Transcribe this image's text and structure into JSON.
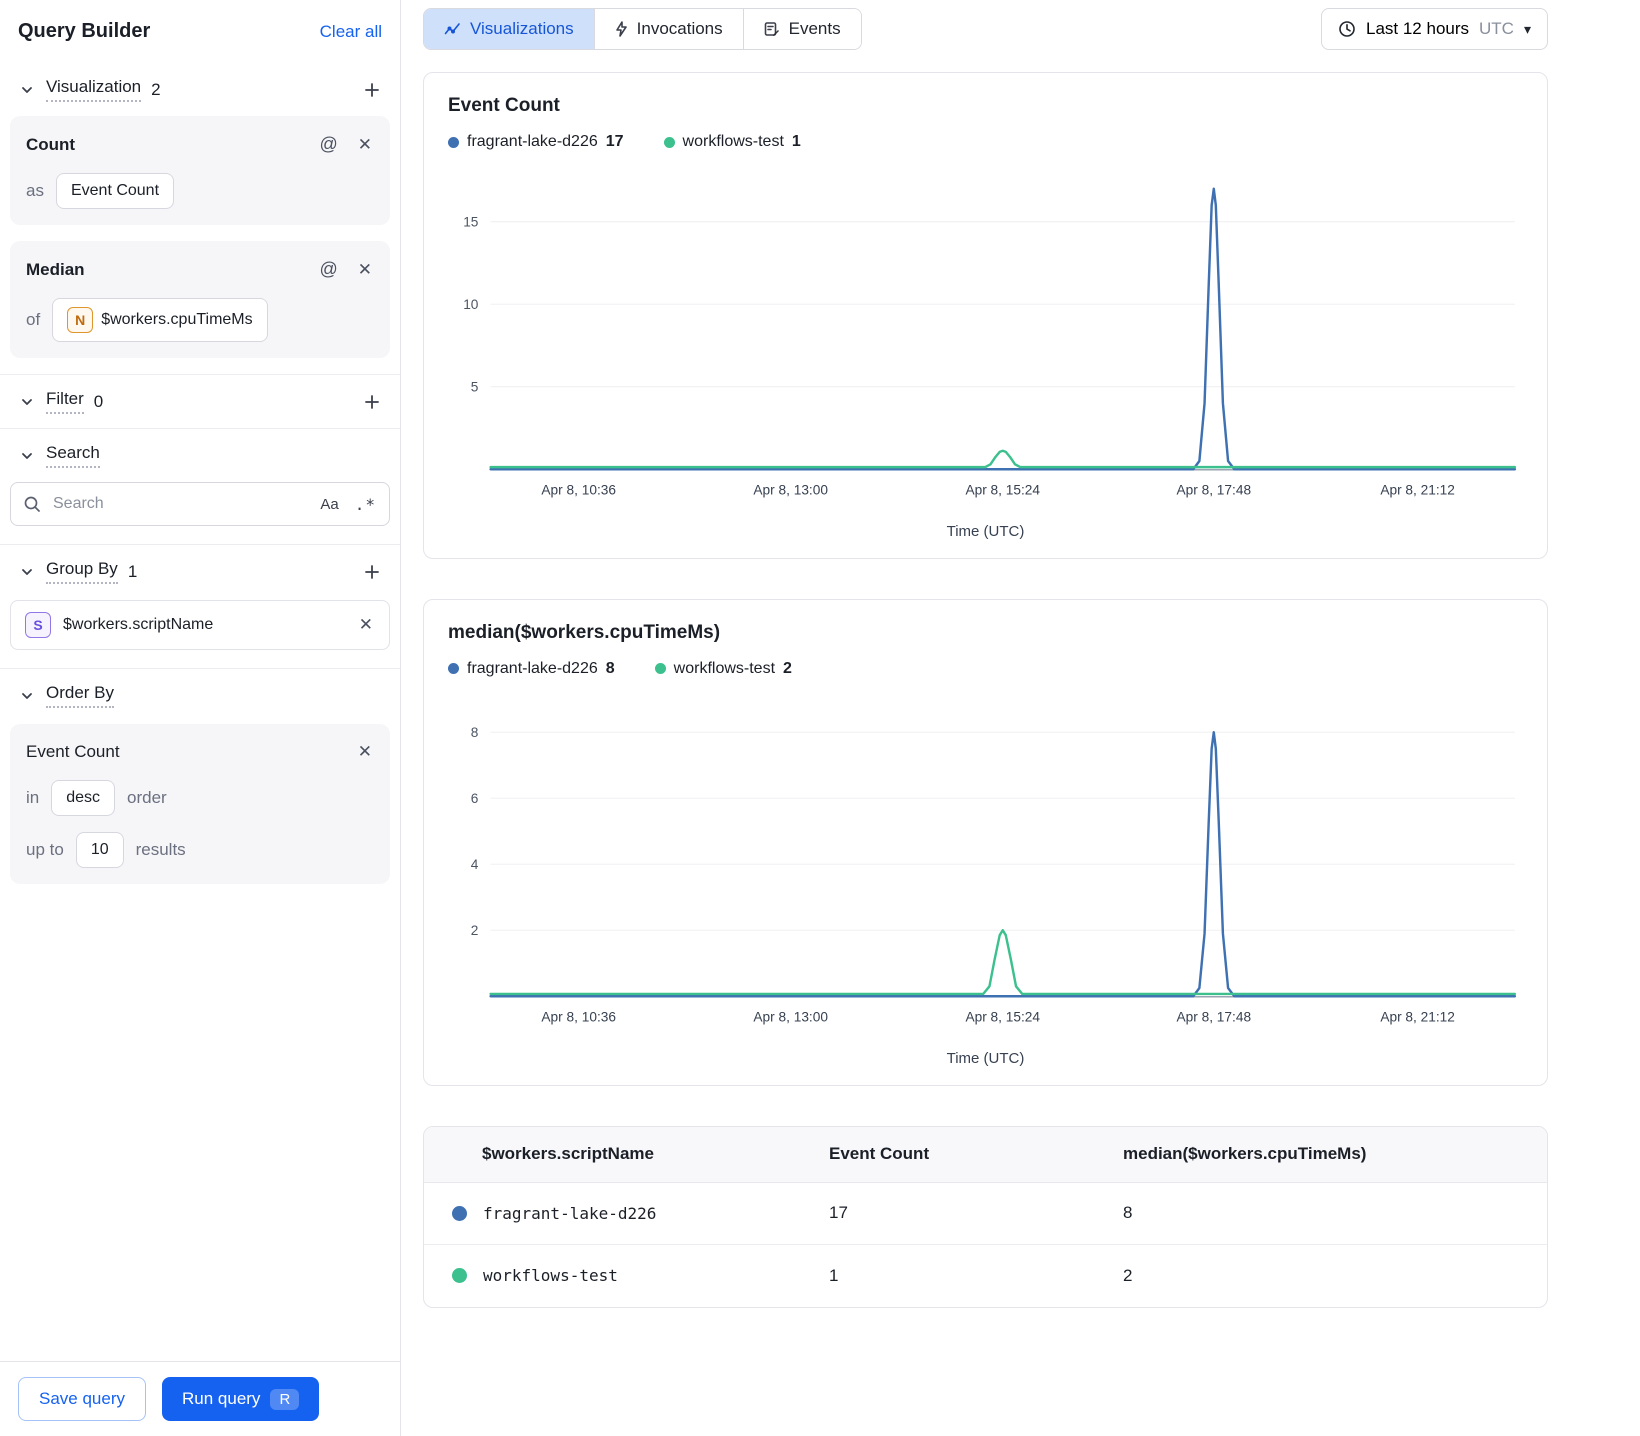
{
  "colors": {
    "accent_blue": "#1662f0",
    "tab_active_bg": "#cfe0fb",
    "series_blue": "#3e70b2",
    "series_green": "#3cc08d"
  },
  "icons": {
    "at_sign": "@",
    "close": "✕",
    "case_sensitive": "Aa",
    "regex": ".*",
    "caret_down": "▾"
  },
  "sidebar": {
    "title": "Query Builder",
    "clear_all": "Clear all",
    "visualization": {
      "label": "Visualization",
      "count": "2",
      "cards": [
        {
          "title": "Count",
          "prefix": "as",
          "value": "Event Count"
        },
        {
          "title": "Median",
          "prefix": "of",
          "badge": "N",
          "value": "$workers.cpuTimeMs"
        }
      ]
    },
    "filter": {
      "label": "Filter",
      "count": "0"
    },
    "search": {
      "label": "Search",
      "placeholder": "Search"
    },
    "group_by": {
      "label": "Group By",
      "count": "1",
      "items": [
        {
          "badge": "S",
          "value": "$workers.scriptName"
        }
      ]
    },
    "order_by": {
      "label": "Order By",
      "card": {
        "title": "Event Count",
        "in_label": "in",
        "order_value": "desc",
        "order_suffix": "order",
        "upto_label": "up to",
        "limit": "10",
        "results_label": "results"
      }
    },
    "footer": {
      "save": "Save query",
      "run": "Run query",
      "run_kbd": "R"
    }
  },
  "header": {
    "tabs": [
      {
        "label": "Visualizations",
        "active": true
      },
      {
        "label": "Invocations",
        "active": false
      },
      {
        "label": "Events",
        "active": false
      }
    ],
    "time_range": {
      "label": "Last 12 hours",
      "tz": "UTC"
    }
  },
  "chart_data": [
    {
      "type": "line",
      "title": "Event Count",
      "xlabel": "Time (UTC)",
      "ylim": [
        0,
        17.7
      ],
      "y_ticks": [
        "15",
        "10",
        "5"
      ],
      "x_ticks": [
        {
          "pos": 0.086,
          "label": "Apr 8, 10:36"
        },
        {
          "pos": 0.293,
          "label": "Apr 8, 13:00"
        },
        {
          "pos": 0.5,
          "label": "Apr 8, 15:24"
        },
        {
          "pos": 0.706,
          "label": "Apr 8, 17:48"
        },
        {
          "pos": 0.905,
          "label": "Apr 8, 21:12"
        }
      ],
      "legend": [
        {
          "name": "fragrant-lake-d226",
          "value": "17",
          "color": "#3e70b2"
        },
        {
          "name": "workflows-test",
          "value": "1",
          "color": "#3cc08d"
        }
      ],
      "series": [
        {
          "name": "fragrant-lake-d226",
          "color": "#3e70b2",
          "points": [
            [
              0,
              0
            ],
            [
              0.686,
              0
            ],
            [
              0.692,
              0.5
            ],
            [
              0.697,
              4
            ],
            [
              0.701,
              11
            ],
            [
              0.704,
              16
            ],
            [
              0.706,
              17
            ],
            [
              0.708,
              16
            ],
            [
              0.711,
              11
            ],
            [
              0.715,
              4
            ],
            [
              0.72,
              0.5
            ],
            [
              0.726,
              0
            ],
            [
              1,
              0
            ]
          ]
        },
        {
          "name": "workflows-test",
          "color": "#3cc08d",
          "points": [
            [
              0,
              0.13
            ],
            [
              0.483,
              0.13
            ],
            [
              0.488,
              0.3
            ],
            [
              0.493,
              0.75
            ],
            [
              0.497,
              1.05
            ],
            [
              0.5,
              1.12
            ],
            [
              0.503,
              1.05
            ],
            [
              0.507,
              0.75
            ],
            [
              0.512,
              0.3
            ],
            [
              0.517,
              0.13
            ],
            [
              1,
              0.13
            ]
          ]
        }
      ]
    },
    {
      "type": "line",
      "title": "median($workers.cpuTimeMs)",
      "xlabel": "Time (UTC)",
      "ylim": [
        0,
        8.85
      ],
      "y_ticks": [
        "8",
        "6",
        "4",
        "2"
      ],
      "x_ticks": [
        {
          "pos": 0.086,
          "label": "Apr 8, 10:36"
        },
        {
          "pos": 0.293,
          "label": "Apr 8, 13:00"
        },
        {
          "pos": 0.5,
          "label": "Apr 8, 15:24"
        },
        {
          "pos": 0.706,
          "label": "Apr 8, 17:48"
        },
        {
          "pos": 0.905,
          "label": "Apr 8, 21:12"
        }
      ],
      "legend": [
        {
          "name": "fragrant-lake-d226",
          "value": "8",
          "color": "#3e70b2"
        },
        {
          "name": "workflows-test",
          "value": "2",
          "color": "#3cc08d"
        }
      ],
      "series": [
        {
          "name": "fragrant-lake-d226",
          "color": "#3e70b2",
          "points": [
            [
              0,
              0
            ],
            [
              0.686,
              0
            ],
            [
              0.692,
              0.25
            ],
            [
              0.697,
              1.9
            ],
            [
              0.701,
              5.2
            ],
            [
              0.704,
              7.5
            ],
            [
              0.706,
              8
            ],
            [
              0.708,
              7.5
            ],
            [
              0.711,
              5.2
            ],
            [
              0.715,
              1.9
            ],
            [
              0.72,
              0.25
            ],
            [
              0.726,
              0
            ],
            [
              1,
              0
            ]
          ]
        },
        {
          "name": "workflows-test",
          "color": "#3cc08d",
          "points": [
            [
              0,
              0.07
            ],
            [
              0.481,
              0.07
            ],
            [
              0.487,
              0.3
            ],
            [
              0.492,
              1.1
            ],
            [
              0.497,
              1.85
            ],
            [
              0.5,
              2
            ],
            [
              0.503,
              1.85
            ],
            [
              0.508,
              1.1
            ],
            [
              0.513,
              0.3
            ],
            [
              0.519,
              0.07
            ],
            [
              1,
              0.07
            ]
          ]
        }
      ]
    }
  ],
  "table": {
    "headers": [
      "$workers.scriptName",
      "Event Count",
      "median($workers.cpuTimeMs)"
    ],
    "rows": [
      {
        "color": "#3e70b2",
        "script": "fragrant-lake-d226",
        "count": "17",
        "median": "8"
      },
      {
        "color": "#3cc08d",
        "script": "workflows-test",
        "count": "1",
        "median": "2"
      }
    ]
  }
}
